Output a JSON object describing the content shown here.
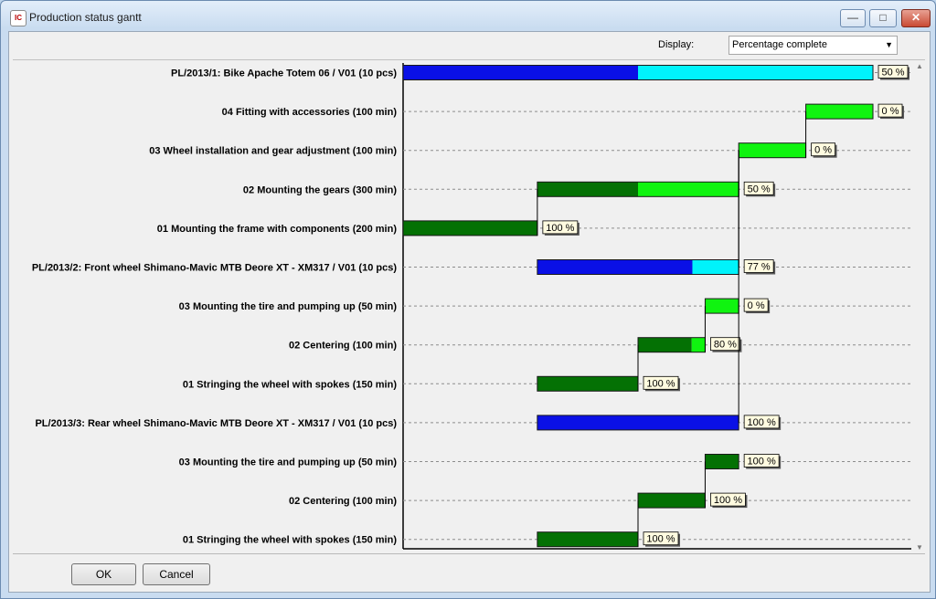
{
  "window": {
    "title": "Production status gantt",
    "app_icon": "IC"
  },
  "toolbar": {
    "display_label": "Display:",
    "display_value": "Percentage complete"
  },
  "buttons": {
    "ok": "OK",
    "cancel": "Cancel"
  },
  "colors": {
    "plan_done": "#0a10e6",
    "plan_todo": "#00f3fb",
    "task_done": "#047104",
    "task_todo": "#10f410"
  },
  "chart_data": {
    "type": "gantt",
    "rows": [
      {
        "label": "PL/2013/1: Bike Apache Totem 06 / V01 (10 pcs)",
        "kind": "plan",
        "start": 0,
        "end": 700,
        "progress": 0.5,
        "badge": "50 %"
      },
      {
        "label": "04 Fitting with accessories (100 min)",
        "kind": "task",
        "start": 600,
        "end": 700,
        "progress": 0,
        "badge": "0 %"
      },
      {
        "label": "03 Wheel installation and gear adjustment (100 min)",
        "kind": "task",
        "start": 500,
        "end": 600,
        "progress": 0,
        "badge": "0 %"
      },
      {
        "label": "02 Mounting the gears (300 min)",
        "kind": "task",
        "start": 200,
        "end": 500,
        "progress": 0.5,
        "badge": "50 %"
      },
      {
        "label": "01 Mounting the frame with components (200 min)",
        "kind": "task",
        "start": 0,
        "end": 200,
        "progress": 1,
        "badge": "100 %"
      },
      {
        "label": "PL/2013/2: Front wheel Shimano-Mavic MTB Deore XT - XM317 / V01 (10 pcs)",
        "kind": "plan",
        "start": 200,
        "end": 500,
        "progress": 0.77,
        "badge": "77 %"
      },
      {
        "label": "03 Mounting the tire and pumping up (50 min)",
        "kind": "task",
        "start": 450,
        "end": 500,
        "progress": 0,
        "badge": "0 %"
      },
      {
        "label": "02 Centering (100 min)",
        "kind": "task",
        "start": 350,
        "end": 450,
        "progress": 0.8,
        "badge": "80 %"
      },
      {
        "label": "01 Stringing the wheel with spokes (150 min)",
        "kind": "task",
        "start": 200,
        "end": 350,
        "progress": 1,
        "badge": "100 %"
      },
      {
        "label": "PL/2013/3: Rear wheel Shimano-Mavic MTB Deore XT - XM317 / V01 (10 pcs)",
        "kind": "plan",
        "start": 200,
        "end": 500,
        "progress": 1,
        "badge": "100 %"
      },
      {
        "label": "03 Mounting the tire and pumping up (50 min)",
        "kind": "task",
        "start": 450,
        "end": 500,
        "progress": 1,
        "badge": "100 %"
      },
      {
        "label": "02 Centering (100 min)",
        "kind": "task",
        "start": 350,
        "end": 450,
        "progress": 1,
        "badge": "100 %"
      },
      {
        "label": "01 Stringing the wheel with spokes (150 min)",
        "kind": "task",
        "start": 200,
        "end": 350,
        "progress": 1,
        "badge": "100 %"
      }
    ],
    "dependencies": [
      [
        4,
        3
      ],
      [
        3,
        2
      ],
      [
        2,
        1
      ],
      [
        8,
        7
      ],
      [
        7,
        6
      ],
      [
        12,
        11
      ],
      [
        11,
        10
      ]
    ]
  }
}
